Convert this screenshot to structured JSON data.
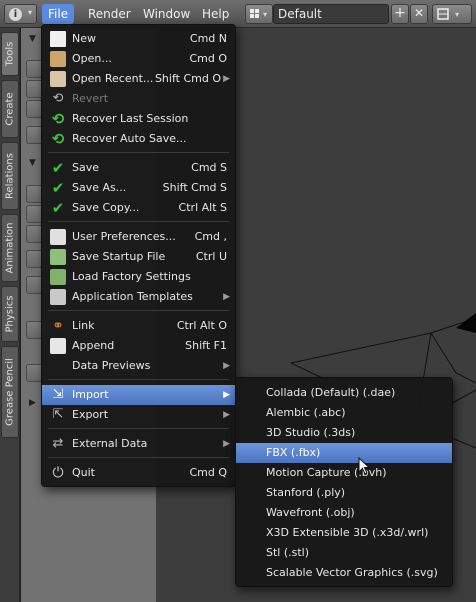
{
  "header": {
    "info_icon": "i",
    "menus": [
      "File",
      "Render",
      "Window",
      "Help"
    ],
    "layout_value": "Default",
    "plus": "+",
    "close": "✕"
  },
  "shelf_tabs": [
    "Tools",
    "Create",
    "Relations",
    "Animation",
    "Physics",
    "Grease Pencil"
  ],
  "file_menu": {
    "items": [
      {
        "label": "New",
        "shortcut": "Cmd N",
        "icon": "new-file-icon"
      },
      {
        "label": "Open...",
        "shortcut": "Cmd O",
        "icon": "folder-icon"
      },
      {
        "label": "Open Recent...",
        "shortcut": "Shift Cmd O",
        "icon": "open-recent-icon"
      },
      {
        "label": "Revert",
        "shortcut": "",
        "icon": "revert-icon"
      },
      {
        "label": "Recover Last Session",
        "shortcut": "",
        "icon": "recover-icon"
      },
      {
        "label": "Recover Auto Save...",
        "shortcut": "",
        "icon": "recover-icon"
      },
      {
        "label": "Save",
        "shortcut": "Cmd S",
        "icon": "checkmark-icon"
      },
      {
        "label": "Save As...",
        "shortcut": "Shift Cmd S",
        "icon": "checkmark-icon"
      },
      {
        "label": "Save Copy...",
        "shortcut": "Ctrl Alt S",
        "icon": "checkmark-icon"
      },
      {
        "label": "User Preferences...",
        "shortcut": "Cmd ,",
        "icon": "preferences-icon"
      },
      {
        "label": "Save Startup File",
        "shortcut": "Ctrl U",
        "icon": "save-startup-icon"
      },
      {
        "label": "Load Factory Settings",
        "shortcut": "",
        "icon": "factory-settings-icon"
      },
      {
        "label": "Application Templates",
        "shortcut": "",
        "icon": "templates-icon"
      },
      {
        "label": "Link",
        "shortcut": "Ctrl Alt O",
        "icon": "link-icon"
      },
      {
        "label": "Append",
        "shortcut": "Shift F1",
        "icon": "append-icon"
      },
      {
        "label": "Data Previews",
        "shortcut": "",
        "icon": ""
      },
      {
        "label": "Import",
        "shortcut": "",
        "icon": "import-icon"
      },
      {
        "label": "Export",
        "shortcut": "",
        "icon": "export-icon"
      },
      {
        "label": "External Data",
        "shortcut": "",
        "icon": "external-data-icon"
      },
      {
        "label": "Quit",
        "shortcut": "Cmd Q",
        "icon": "power-icon"
      }
    ]
  },
  "import_menu": {
    "items": [
      "Collada (Default) (.dae)",
      "Alembic (.abc)",
      "3D Studio (.3ds)",
      "FBX (.fbx)",
      "Motion Capture (.bvh)",
      "Stanford (.ply)",
      "Wavefront (.obj)",
      "X3D Extensible 3D (.x3d/.wrl)",
      "Stl (.stl)",
      "Scalable Vector Graphics (.svg)"
    ]
  },
  "colors": {
    "highlight": "#5a8be0",
    "menu_bg": "#181818",
    "viewport_bg": "#3d3d3d"
  }
}
